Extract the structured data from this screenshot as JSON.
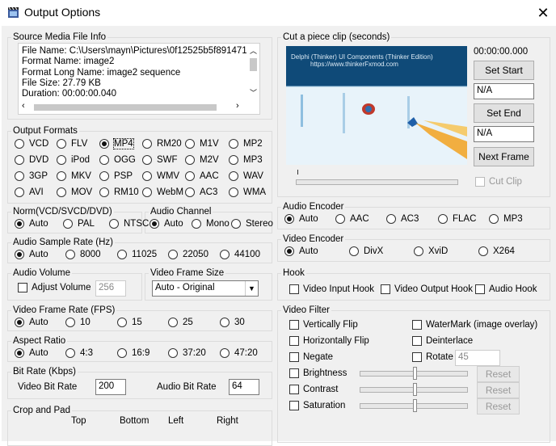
{
  "window": {
    "title": "Output Options",
    "close": "✕"
  },
  "source": {
    "legend": "Source Media File Info",
    "lines": [
      "File Name: C:\\Users\\mayn\\Pictures\\0f12525b5f8914716",
      "Format Name: image2",
      "Format Long Name: image2 sequence",
      "File Size: 27.79 KB",
      "Duration: 00:00:00.040"
    ]
  },
  "formats": {
    "legend": "Output Formats",
    "options": [
      "VCD",
      "FLV",
      "MP4",
      "RM20",
      "M1V",
      "MP2",
      "DVD",
      "iPod",
      "OGG",
      "SWF",
      "M2V",
      "MP3",
      "3GP",
      "MKV",
      "PSP",
      "WMV",
      "AAC",
      "WAV",
      "AVI",
      "MOV",
      "RM10",
      "WebM",
      "AC3",
      "WMA"
    ],
    "selected": "MP4"
  },
  "norm": {
    "legend": "Norm(VCD/SVCD/DVD)",
    "options": [
      "Auto",
      "PAL",
      "NTSC"
    ],
    "selected": "Auto"
  },
  "audio_channel": {
    "legend": "Audio Channel",
    "options": [
      "Auto",
      "Mono",
      "Stereo"
    ],
    "selected": "Auto"
  },
  "sample_rate": {
    "legend": "Audio Sample Rate (Hz)",
    "options": [
      "Auto",
      "8000",
      "11025",
      "22050",
      "44100"
    ],
    "selected": "Auto"
  },
  "audio_volume": {
    "legend": "Audio Volume",
    "check_label": "Adjust Volume",
    "value": "256"
  },
  "frame_size": {
    "legend": "Video Frame Size",
    "value": "Auto - Original"
  },
  "frame_rate": {
    "legend": "Video Frame Rate (FPS)",
    "options": [
      "Auto",
      "10",
      "15",
      "25",
      "30"
    ],
    "selected": "Auto"
  },
  "aspect": {
    "legend": "Aspect Ratio",
    "options": [
      "Auto",
      "4:3",
      "16:9",
      "37:20",
      "47:20"
    ],
    "selected": "Auto"
  },
  "bitrate": {
    "legend": "Bit Rate (Kbps)",
    "video_label": "Video Bit Rate",
    "video_value": "200",
    "audio_label": "Audio Bit Rate",
    "audio_value": "64"
  },
  "crop": {
    "legend": "Crop and Pad",
    "cols": [
      "Top",
      "Bottom",
      "Left",
      "Right"
    ]
  },
  "cut": {
    "legend": "Cut a piece clip (seconds)",
    "time": "00:00:00.000",
    "set_start": "Set Start",
    "start_value": "N/A",
    "set_end": "Set End",
    "end_value": "N/A",
    "next_frame": "Next Frame",
    "cut_clip": "Cut Clip",
    "preview_text1": "Delphi (Thinker) UI Components (Thinker Edition)",
    "preview_text2": "https://www.thinkerFxmod.com"
  },
  "audio_encoder": {
    "legend": "Audio Encoder",
    "options": [
      "Auto",
      "AAC",
      "AC3",
      "FLAC",
      "MP3"
    ],
    "selected": "Auto"
  },
  "video_encoder": {
    "legend": "Video Encoder",
    "options": [
      "Auto",
      "DivX",
      "XviD",
      "X264"
    ],
    "selected": "Auto"
  },
  "hook": {
    "legend": "Hook",
    "options": [
      "Video Input Hook",
      "Video Output Hook",
      "Audio Hook"
    ]
  },
  "filter": {
    "legend": "Video Filter",
    "left": [
      "Vertically Flip",
      "Horizontally Flip",
      "Negate",
      "Brightness",
      "Contrast",
      "Saturation"
    ],
    "right": [
      "WaterMark (image overlay)",
      "Deinterlace",
      "Rotate"
    ],
    "rotate_value": "45",
    "reset": "Reset"
  }
}
